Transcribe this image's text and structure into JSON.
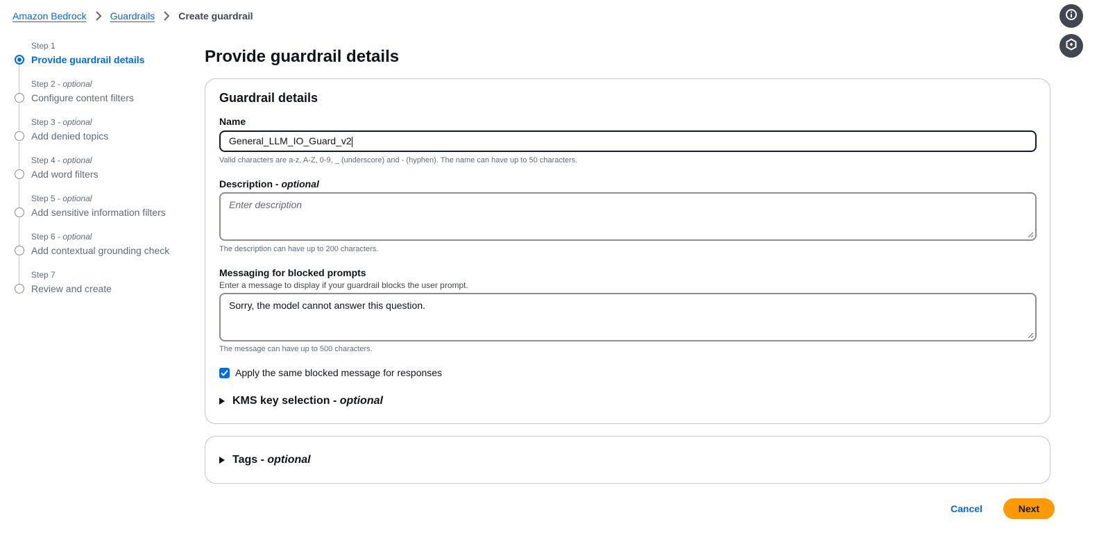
{
  "breadcrumb": {
    "items": [
      "Amazon Bedrock",
      "Guardrails"
    ],
    "current": "Create guardrail"
  },
  "steps": [
    {
      "num": "Step 1",
      "optional": "",
      "title": "Provide guardrail details"
    },
    {
      "num": "Step 2",
      "optional": "optional",
      "title": "Configure content filters"
    },
    {
      "num": "Step 3",
      "optional": "optional",
      "title": "Add denied topics"
    },
    {
      "num": "Step 4",
      "optional": "optional",
      "title": "Add word filters"
    },
    {
      "num": "Step 5",
      "optional": "optional",
      "title": "Add sensitive information filters"
    },
    {
      "num": "Step 6",
      "optional": "optional",
      "title": "Add contextual grounding check"
    },
    {
      "num": "Step 7",
      "optional": "",
      "title": "Review and create"
    }
  ],
  "page_title": "Provide guardrail details",
  "details": {
    "heading": "Guardrail details",
    "name": {
      "label": "Name",
      "value": "General_LLM_IO_Guard_v2",
      "hint": "Valid characters are a-z, A-Z, 0-9, _ (underscore) and - (hyphen). The name can have up to 50 characters."
    },
    "description": {
      "label": "Description",
      "optional": "optional",
      "placeholder": "Enter description",
      "hint": "The description can have up to 200 characters."
    },
    "blocked_prompts": {
      "label": "Messaging for blocked prompts",
      "desc": "Enter a message to display if your guardrail blocks the user prompt.",
      "value": "Sorry, the model cannot answer this question.",
      "hint": "The message can have up to 500 characters."
    },
    "checkbox_label": "Apply the same blocked message for responses",
    "kms": {
      "label": "KMS key selection",
      "optional": "optional"
    }
  },
  "tags": {
    "label": "Tags",
    "optional": "optional"
  },
  "actions": {
    "cancel": "Cancel",
    "next": "Next"
  },
  "colors": {
    "accent": "#006ce0",
    "primary_button": "#ff9900"
  }
}
